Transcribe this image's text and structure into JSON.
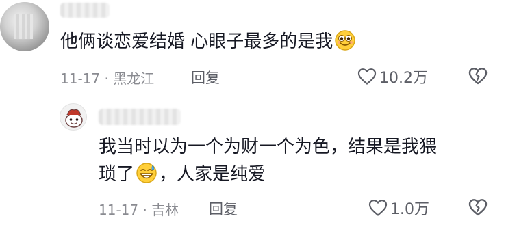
{
  "comments": [
    {
      "text": "他俩谈恋爱结婚 心眼子最多的是我",
      "emoji": "smile-emoji",
      "meta": "11-17 · 黑龙江",
      "reply_label": "回复",
      "likes": "10.2万"
    },
    {
      "text_line1": "我当时以为一个为财一个为色，结果是我猥",
      "text_line2_a": "琐了",
      "emoji": "sweat-grin-emoji",
      "text_line2_b": "，人家是纯爱",
      "meta": "11-17 · 吉林",
      "reply_label": "回复",
      "likes": "1.0万"
    }
  ]
}
